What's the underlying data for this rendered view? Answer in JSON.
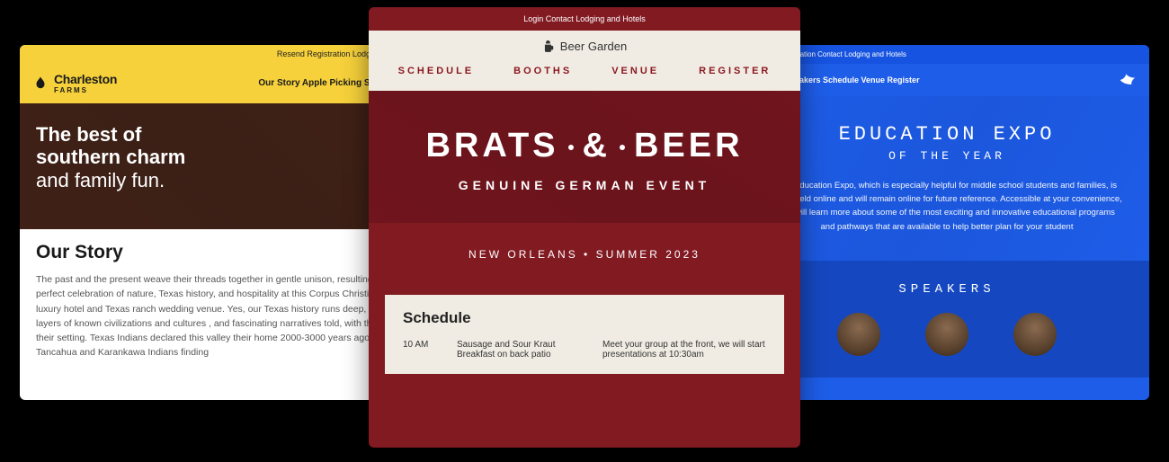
{
  "card1": {
    "topbar": "Resend Registration   Lodging and Hot",
    "logo_main": "Charleston",
    "logo_sub": "FARMS",
    "nav": "Our Story   Apple Picking   Shop   Ticke",
    "hero_bold": "The best of\nsouthern charm",
    "hero_light": "and family fun.",
    "section_title": "Our Story",
    "body": "The past and the present weave their threads together in gentle unison, resulting in a perfect celebration of nature, Texas history, and hospitality at this Corpus Christi small luxury hotel and Texas ranch wedding venue. Yes, our Texas history runs deep, with layers of known civilizations and cultures , and fascinating narratives told, with this as their setting. Texas Indians declared this valley their home 2000-3000 years ago, with Tancahua and Karankawa Indians finding"
  },
  "card2": {
    "topbar": "Login   Contact   Lodging and Hotels",
    "logo": "Beer Garden",
    "nav": [
      "SCHEDULE",
      "BOOTHS",
      "VENUE",
      "REGISTER"
    ],
    "hero_line1a": "BRATS",
    "hero_line1b": "&",
    "hero_line1c": "BEER",
    "hero_line2": "GENUINE GERMAN EVENT",
    "sub": "NEW ORLEANS   •   SUMMER 2023",
    "sched_title": "Schedule",
    "sched_time": "10 AM",
    "sched_col1": "Sausage and Sour Kraut Breakfast on back patio",
    "sched_col2": "Meet your group at the front, we will start presentations at 10:30am"
  },
  "card3": {
    "topbar_left": "esder Registration     Contact     Lodging and Hotels",
    "nav": "out Us   Speakers   Schedule   Venue   Register",
    "hero_t1": "EDUCATION EXPO",
    "hero_t2": "OF THE YEAR",
    "hero_text": "The Education Expo, which is especially helpful for middle school students and families, is being held online and will remain online for future reference. Accessible at your convenience, you will learn more about some of the most exciting and innovative educational programs and pathways that are available to help better plan for your student",
    "speakers_title": "SPEAKERS"
  }
}
